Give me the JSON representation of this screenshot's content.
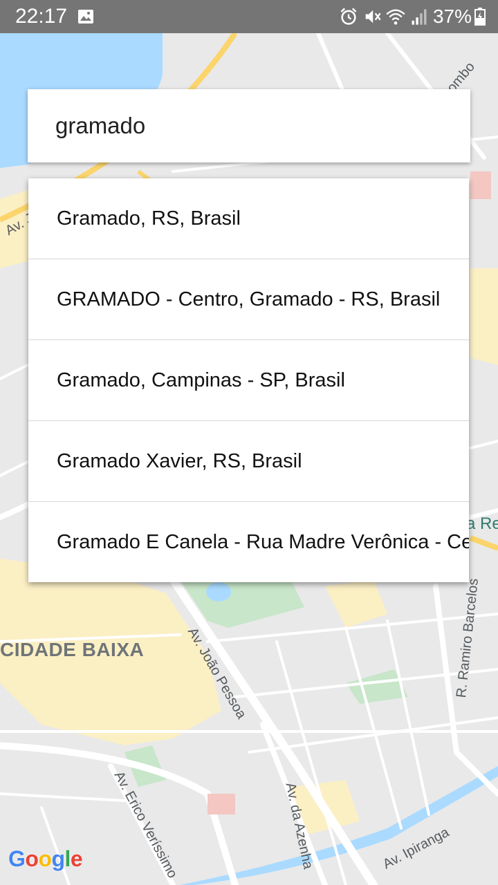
{
  "status_bar": {
    "time": "22:17",
    "battery": "37%",
    "icons": [
      "gallery-icon",
      "alarm-icon",
      "vibrate-mute-icon",
      "wifi-icon",
      "signal-icon",
      "battery-icon"
    ]
  },
  "search": {
    "value": "gramado"
  },
  "suggestions": [
    "Gramado, RS, Brasil",
    "GRAMADO - Centro, Gramado - RS, Brasil",
    "Gramado, Campinas - SP, Brasil",
    "Gramado Xavier, RS, Brasil",
    "Gramado E Canela - Rua Madre Verônica - Centro"
  ],
  "map": {
    "district": "CIDADE BAIXA",
    "streets": {
      "joao_pessoa": "Av. João Pessoa",
      "da_azenha": "Av. da Azenha",
      "erico_verissimo": "Av. Erico Veríssimo",
      "ipiranga": "Av. Ipiranga",
      "ramiro_barcelos": "R. Ramiro Barcelos",
      "av_partial": "Av. J",
      "ombo_partial": "ombo",
      "re_partial": "a Re"
    },
    "colors": {
      "water": "#aadaff",
      "park": "#c8e6c9",
      "commercial": "#fbefc4",
      "road": "#ffffff",
      "highway": "#fbd46b"
    }
  },
  "attribution": "Google"
}
